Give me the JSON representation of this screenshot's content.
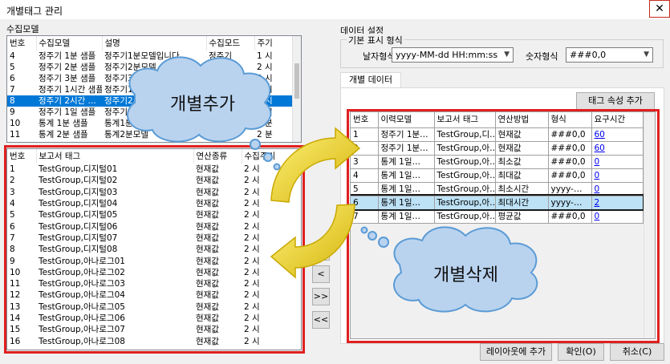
{
  "window": {
    "title": "개별태그 관리",
    "close": "✕"
  },
  "left_group": {
    "title": "수집모델",
    "columns": [
      "번호",
      "수집모델",
      "설명",
      "수집모드",
      "주기"
    ],
    "rows": [
      [
        "4",
        "정주기 1분 샘플",
        "정주기1분모델입니다.",
        "정주기",
        "1 시"
      ],
      [
        "5",
        "정주기 2분 샘플",
        "정주기2분모델",
        "정주기",
        "2 시"
      ],
      [
        "6",
        "정주기 3분 샘플",
        "정주기3분모델",
        "정주기",
        "3 시"
      ],
      [
        "7",
        "정주기 1시간 샘플",
        "정주기1시간",
        "정주기",
        "1 시"
      ],
      [
        "8",
        "정주기 2시간 ...",
        "정주기2시간",
        "정주기",
        "2 시"
      ],
      [
        "9",
        "정주기 1일 샘플",
        "정주기1일",
        "정주기",
        "1 일"
      ],
      [
        "10",
        "통계 1분 샘플",
        "통계1분",
        "통계",
        "1 분"
      ],
      [
        "11",
        "통계 2분 샘플",
        "통계2분모델",
        "통계",
        "2 분"
      ]
    ],
    "selected_row": 4
  },
  "tag_list": {
    "columns": [
      "번호",
      "보고서 태그",
      "연산종류",
      "수집주기"
    ],
    "rows": [
      [
        "1",
        "TestGroup,디지털01",
        "현재값",
        "2 시"
      ],
      [
        "2",
        "TestGroup,디지털02",
        "현재값",
        "2 시"
      ],
      [
        "3",
        "TestGroup,디지털03",
        "현재값",
        "2 시"
      ],
      [
        "4",
        "TestGroup,디지털04",
        "현재값",
        "2 시"
      ],
      [
        "5",
        "TestGroup,디지털05",
        "현재값",
        "2 시"
      ],
      [
        "6",
        "TestGroup,디지털06",
        "현재값",
        "2 시"
      ],
      [
        "7",
        "TestGroup,디지털07",
        "현재값",
        "2 시"
      ],
      [
        "8",
        "TestGroup,디지털08",
        "현재값",
        "2 시"
      ],
      [
        "9",
        "TestGroup,아나로그01",
        "현재값",
        "2 시"
      ],
      [
        "10",
        "TestGroup,아나로그02",
        "현재값",
        "2 시"
      ],
      [
        "11",
        "TestGroup,아나로그03",
        "현재값",
        "2 시"
      ],
      [
        "12",
        "TestGroup,아나로그04",
        "현재값",
        "2 시"
      ],
      [
        "13",
        "TestGroup,아나로그05",
        "현재값",
        "2 시"
      ],
      [
        "14",
        "TestGroup,아나로그06",
        "현재값",
        "2 시"
      ],
      [
        "15",
        "TestGroup,아나로그07",
        "현재값",
        "2 시"
      ],
      [
        "16",
        "TestGroup,아나로그08",
        "현재값",
        "2 시"
      ]
    ]
  },
  "transfer_buttons": {
    "add_one": ">",
    "remove_one": "<",
    "add_all": ">>",
    "remove_all": "<<"
  },
  "data_settings": {
    "title": "데이터 설정",
    "display_group": "기본 표시 형식",
    "date_label": "날자형식",
    "date_value": "yyyy-MM-dd HH:mm:ss",
    "number_label": "숫자형식",
    "number_value": "###0,0"
  },
  "individual": {
    "tab": "개별 데이터",
    "add_attr_button": "태그 속성 추가",
    "columns": [
      "번호",
      "이력모델",
      "보고서 태그",
      "연산방법",
      "형식",
      "요구시간"
    ],
    "rows": [
      [
        "1",
        "정주기 1분…",
        "TestGroup,디…",
        "현재값",
        "###0,0",
        "60"
      ],
      [
        "2",
        "정주기 1분…",
        "TestGroup,아…",
        "현재값",
        "###0,0",
        "60"
      ],
      [
        "3",
        "통계 1일…",
        "TestGroup,아…",
        "최소값",
        "###0,0",
        "0"
      ],
      [
        "4",
        "통계 1일…",
        "TestGroup,아…",
        "최대값",
        "###0,0",
        "0"
      ],
      [
        "5",
        "통계 1일…",
        "TestGroup,아…",
        "최소시간",
        "yyyy-…",
        "0"
      ],
      [
        "6",
        "통계 1일…",
        "TestGroup,아…",
        "최대시간",
        "yyyy-…",
        "2"
      ],
      [
        "7",
        "통계 1일…",
        "TestGroup,아…",
        "평균값",
        "###0,0",
        "0"
      ]
    ],
    "highlight_row": 5
  },
  "footer": {
    "layout_button": "레이아웃에 추가",
    "ok_button": "확인(O)",
    "cancel_button": "취소(C)"
  },
  "callouts": {
    "add": "개별추가",
    "delete": "개별삭제"
  },
  "colors": {
    "red_box": "#e02020",
    "selection": "#0078d7",
    "highlight": "#bde2f6",
    "cloud": "#b9d3ef",
    "arrow": "#e8c82a"
  }
}
